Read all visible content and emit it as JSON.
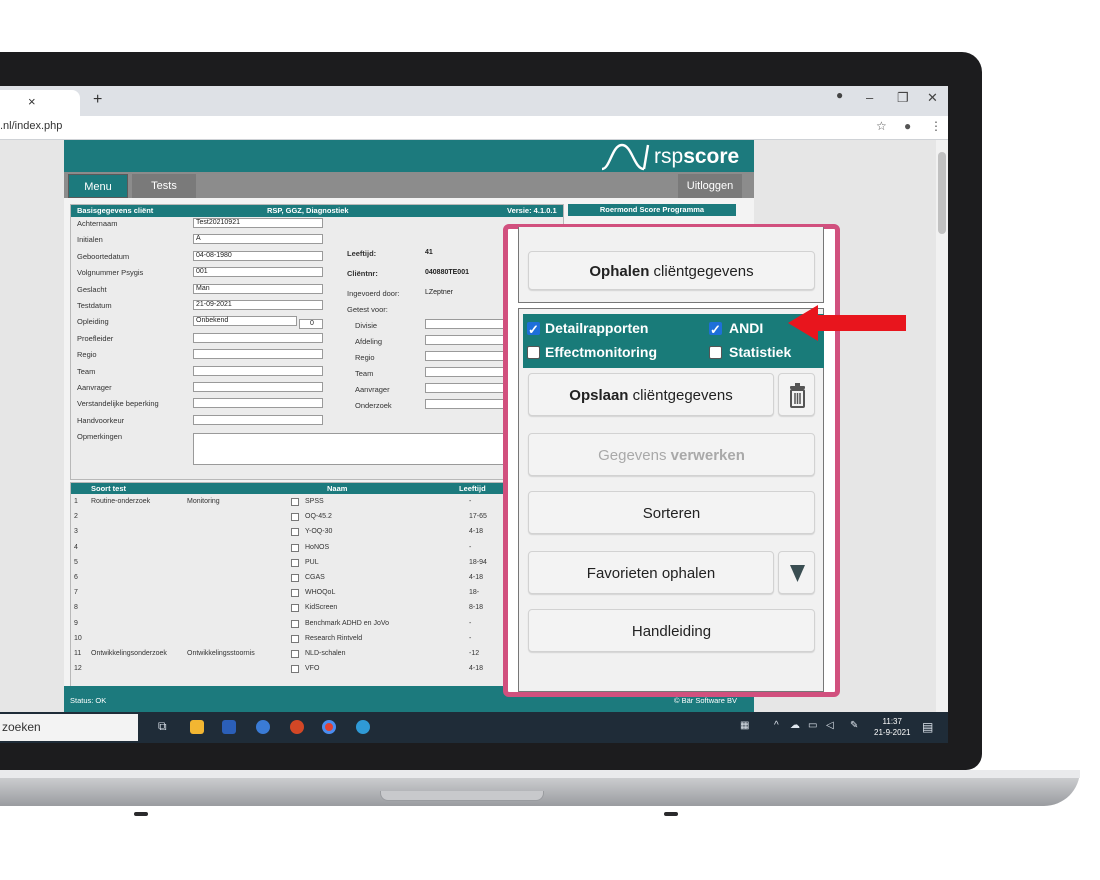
{
  "browser": {
    "tab_close": "×",
    "tab_new": "+",
    "url": ".nl/index.php"
  },
  "app": {
    "logo": {
      "text_light": "rsp",
      "text_bold": "score"
    },
    "nav": {
      "menu": "Menu",
      "tests": "Tests",
      "logout": "Uitloggen"
    },
    "panel": {
      "header_left": "Basisgegevens cliënt",
      "header_mid": "RSP, GGZ, Diagnostiek",
      "header_right": "Versie: 4.1.0.1",
      "side_header": "Roermond Score Programma",
      "fields": [
        {
          "label": "Achternaam",
          "value": "Test20210921"
        },
        {
          "label": "Initialen",
          "value": "A"
        },
        {
          "label": "Geboortedatum",
          "value": "04-08-1980"
        },
        {
          "label": "Volgnummer Psygis",
          "value": "001"
        },
        {
          "label": "Geslacht",
          "value": "Man"
        },
        {
          "label": "Testdatum",
          "value": "21-09-2021"
        },
        {
          "label": "Opleiding",
          "value": "Onbekend"
        },
        {
          "label": "Proefleider",
          "value": ""
        },
        {
          "label": "Regio",
          "value": ""
        },
        {
          "label": "Team",
          "value": ""
        },
        {
          "label": "Aanvrager",
          "value": ""
        },
        {
          "label": "Verstandelijke beperking",
          "value": ""
        },
        {
          "label": "Handvoorkeur",
          "value": ""
        },
        {
          "label": "Opmerkingen",
          "value": ""
        }
      ],
      "opleiding_code": "0",
      "right": {
        "leeftijd_label": "Leeftijd:",
        "leeftijd_value": "41",
        "clientnr_label": "Cliëntnr:",
        "clientnr_value": "040880TE001",
        "ingevoerd_label": "Ingevoerd door:",
        "ingevoerd_value": "LZeptner",
        "getest_label": "Getest voor:",
        "divisie": "Divisie",
        "afdeling": "Afdeling",
        "regio": "Regio",
        "team": "Team",
        "aanvrager": "Aanvrager",
        "onderzoek": "Onderzoek"
      }
    },
    "tests": {
      "head_soort": "Soort test",
      "head_naam": "Naam",
      "head_leeftijd": "Leeftijd",
      "rows": [
        {
          "n": "1",
          "soort": "Routine-onderzoek",
          "sub": "Monitoring",
          "naam": "SPSS",
          "leeftijd": "-"
        },
        {
          "n": "2",
          "soort": "",
          "sub": "",
          "naam": "OQ-45.2",
          "leeftijd": "17-65"
        },
        {
          "n": "3",
          "soort": "",
          "sub": "",
          "naam": "Y-OQ-30",
          "leeftijd": "4-18"
        },
        {
          "n": "4",
          "soort": "",
          "sub": "",
          "naam": "HoNOS",
          "leeftijd": "-"
        },
        {
          "n": "5",
          "soort": "",
          "sub": "",
          "naam": "PUL",
          "leeftijd": "18-94"
        },
        {
          "n": "6",
          "soort": "",
          "sub": "",
          "naam": "CGAS",
          "leeftijd": "4-18"
        },
        {
          "n": "7",
          "soort": "",
          "sub": "",
          "naam": "WHOQoL",
          "leeftijd": "18-"
        },
        {
          "n": "8",
          "soort": "",
          "sub": "",
          "naam": "KidScreen",
          "leeftijd": "8-18"
        },
        {
          "n": "9",
          "soort": "",
          "sub": "",
          "naam": "Benchmark ADHD en JoVo",
          "leeftijd": "-"
        },
        {
          "n": "10",
          "soort": "",
          "sub": "",
          "naam": "Research Rintveld",
          "leeftijd": "-"
        },
        {
          "n": "11",
          "soort": "Ontwikkelingsonderzoek",
          "sub": "Ontwikkelingsstoornis",
          "naam": "NLD-schalen",
          "leeftijd": "-12"
        },
        {
          "n": "12",
          "soort": "",
          "sub": "",
          "naam": "VFO",
          "leeftijd": "4-18"
        }
      ]
    },
    "status": "Status: OK",
    "copyright": "© Bär Software BV"
  },
  "overlay": {
    "fetch_client": {
      "bold": "Ophalen",
      "rest": " cliëntgegevens"
    },
    "options": [
      {
        "label": "Detailrapporten",
        "checked": true
      },
      {
        "label": "ANDI",
        "checked": true
      },
      {
        "label": "Effectmonitoring",
        "checked": false
      },
      {
        "label": "Statistiek",
        "checked": false
      }
    ],
    "save_client": {
      "bold": "Opslaan",
      "rest": " cliëntgegevens"
    },
    "process": {
      "rest": "Gegevens ",
      "bold": "verwerken"
    },
    "sort": "Sorteren",
    "favorites": "Favorieten ophalen",
    "manual": "Handleiding",
    "check_glyph": "✓"
  },
  "taskbar": {
    "search": "zoeken",
    "time": "11:37",
    "date": "21-9-2021"
  },
  "colors": {
    "teal": "#1c7a7d",
    "overlay_border": "#d1507e",
    "arrow": "#e8151d"
  }
}
